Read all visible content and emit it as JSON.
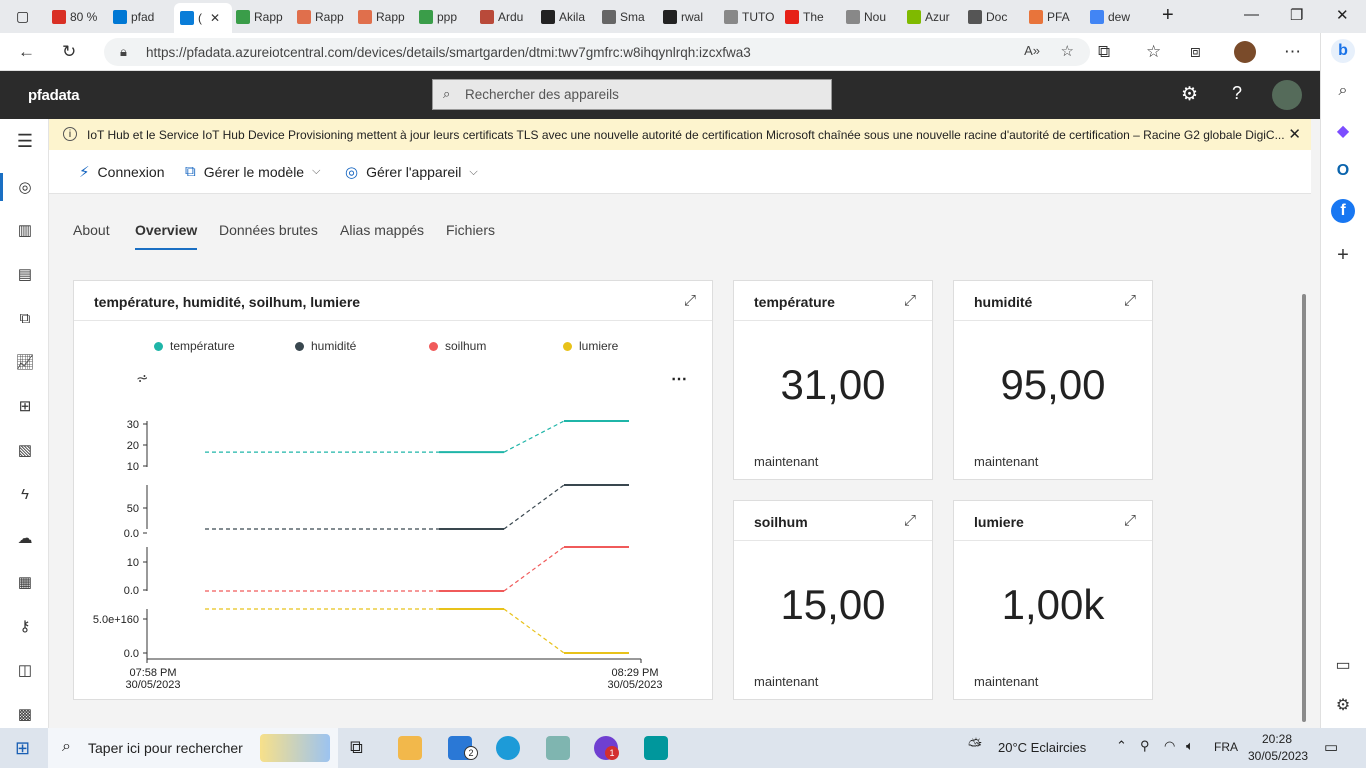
{
  "browser": {
    "tabs": [
      {
        "label": "80 %",
        "icon": "gmail-icon"
      },
      {
        "label": "pfad",
        "icon": "azure-icon"
      },
      {
        "label": "(",
        "icon": "iot-central-icon",
        "active": true
      },
      {
        "label": "Rapp",
        "icon": "leaf-icon"
      },
      {
        "label": "Rapp",
        "icon": "pdf-icon"
      },
      {
        "label": "Rapp",
        "icon": "pdf-icon"
      },
      {
        "label": "ppp",
        "icon": "leaf-icon"
      },
      {
        "label": "Ardu",
        "icon": "f-icon"
      },
      {
        "label": "Akila",
        "icon": "github-icon"
      },
      {
        "label": "Sma",
        "icon": "eg-icon"
      },
      {
        "label": "rwal",
        "icon": "github-icon"
      },
      {
        "label": "TUTO",
        "icon": "page-icon"
      },
      {
        "label": "The",
        "icon": "youtube-icon"
      },
      {
        "label": "Nou",
        "icon": "page-icon"
      },
      {
        "label": "Azur",
        "icon": "microsoft-icon"
      },
      {
        "label": "Doc",
        "icon": "doc-icon"
      },
      {
        "label": "PFA",
        "icon": "pfa-icon"
      },
      {
        "label": "dew",
        "icon": "google-icon"
      }
    ],
    "url": "https://pfadata.azureiotcentral.com/devices/details/smartgarden/dtmi:twv7gmfrc:w8ihqynlrqh:izcxfwa3"
  },
  "app": {
    "brand": "pfadata",
    "search_placeholder": "Rechercher des appareils"
  },
  "banner": {
    "text": "IoT Hub et le Service IoT Hub Device Provisioning mettent à jour leurs certificats TLS avec une nouvelle autorité de certification Microsoft chaînée sous une nouvelle racine d'autorité de certification – Racine G2 globale DigiC..."
  },
  "commands": {
    "connexion": "Connexion",
    "gerer_modele": "Gérer le modèle",
    "gerer_appareil": "Gérer l'appareil"
  },
  "tabs": [
    "About",
    "Overview",
    "Données brutes",
    "Alias mappés",
    "Fichiers"
  ],
  "chart_card": {
    "title": "température, humidité, soilhum, lumiere",
    "x_start_time": "07:58 PM",
    "x_start_date": "30/05/2023",
    "x_end_time": "08:29 PM",
    "x_end_date": "30/05/2023"
  },
  "chart_data": {
    "type": "line",
    "x": [
      "07:58 PM",
      "08:29 PM"
    ],
    "series": [
      {
        "name": "température",
        "color": "#1fb5a8",
        "ticks": [
          "30",
          "20",
          "10"
        ],
        "points": [
          {
            "t": "t1",
            "v": 10
          },
          {
            "t": "t2",
            "v": 10
          },
          {
            "t": "t3",
            "v": 31
          }
        ]
      },
      {
        "name": "humidité",
        "color": "#39474f",
        "ticks": [
          "50",
          "0.0"
        ],
        "points": [
          {
            "t": "t1",
            "v": 0
          },
          {
            "t": "t2",
            "v": 0
          },
          {
            "t": "t3",
            "v": 95
          }
        ]
      },
      {
        "name": "soilhum",
        "color": "#f05a5a",
        "ticks": [
          "10",
          "0.0"
        ],
        "points": [
          {
            "t": "t1",
            "v": 0
          },
          {
            "t": "t2",
            "v": 0
          },
          {
            "t": "t3",
            "v": 15
          }
        ]
      },
      {
        "name": "lumiere",
        "color": "#e8c21a",
        "ticks": [
          "5.0e+160",
          "0.0"
        ],
        "points": [
          {
            "t": "t1",
            "v": 5e+160
          },
          {
            "t": "t2",
            "v": 5e+160
          },
          {
            "t": "t3",
            "v": 1000
          }
        ]
      }
    ]
  },
  "kpis": [
    {
      "title": "température",
      "value": "31,00",
      "sub": "maintenant"
    },
    {
      "title": "humidité",
      "value": "95,00",
      "sub": "maintenant"
    },
    {
      "title": "soilhum",
      "value": "15,00",
      "sub": "maintenant"
    },
    {
      "title": "lumiere",
      "value": "1,00k",
      "sub": "maintenant"
    }
  ],
  "taskbar": {
    "search_placeholder": "Taper ici pour rechercher",
    "weather": "20°C  Eclaircies",
    "lang": "FRA",
    "time": "20:28",
    "date": "30/05/2023",
    "mail_badge": "2",
    "app_badge": "1"
  }
}
